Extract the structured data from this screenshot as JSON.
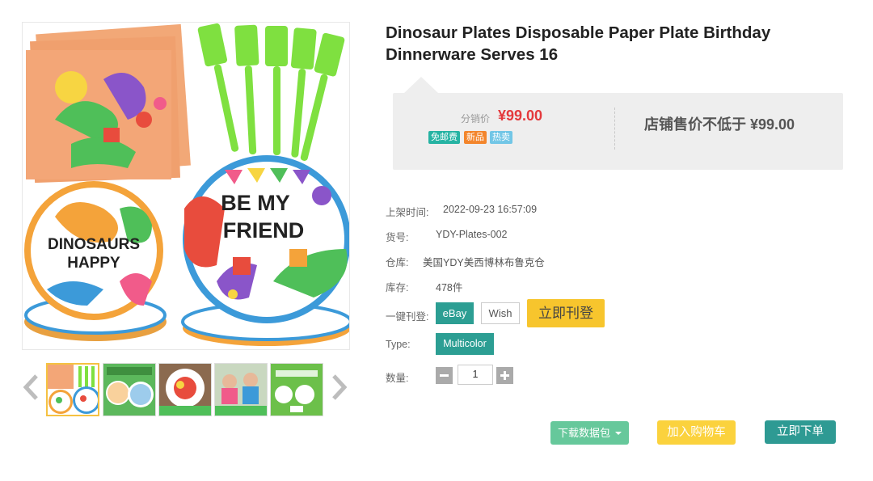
{
  "gallery": {
    "main_image": {
      "alt": "dinosaur-party-tableware-set",
      "plate_text_1": "BE MY",
      "plate_text_2": "FRIEND",
      "plate_text_3": "DINOSAURS",
      "plate_text_4": "HAPPY"
    },
    "thumbnails": [
      {
        "name": "tableware-set",
        "active": true
      },
      {
        "name": "plates-detail",
        "active": false
      },
      {
        "name": "food-on-plate",
        "active": false
      },
      {
        "name": "kids-party",
        "active": false
      },
      {
        "name": "whats-inside",
        "active": false
      }
    ],
    "icons": {
      "prev": "chevron-left-icon",
      "next": "chevron-right-icon"
    }
  },
  "product": {
    "title": "Dinosaur Plates Disposable Paper Plate Birthday Dinnerware Serves 16"
  },
  "price_box": {
    "distribution_label": "分销价",
    "distribution_price": "¥99.00",
    "tags": [
      "免邮费",
      "新品",
      "热卖"
    ],
    "shop_price_text": "店铺售价不低于 ¥99.00",
    "price_color": "#e4393c"
  },
  "specs": {
    "listed_time_label": "上架时间:",
    "listed_time_value": "2022-09-23 16:57:09",
    "sku_label": "货号:",
    "sku_value": "YDY-Plates-002",
    "warehouse_label": "仓库:",
    "warehouse_value": "美国YDY美西博林布鲁克仓",
    "stock_label": "库存:",
    "stock_value": "478件",
    "quick_list_label": "一键刊登:",
    "platform_ebay": "eBay",
    "platform_wish": "Wish",
    "list_now": "立即刊登",
    "type_label": "Type:",
    "type_value": "Multicolor",
    "qty_label": "数量:",
    "qty_value": "1"
  },
  "actions": {
    "download": "下载数据包",
    "add_cart": "加入购物车",
    "buy_now": "立即下单"
  },
  "colors": {
    "teal": "#2c9e93",
    "yellow": "#f7c52d",
    "green": "#66c89b"
  }
}
